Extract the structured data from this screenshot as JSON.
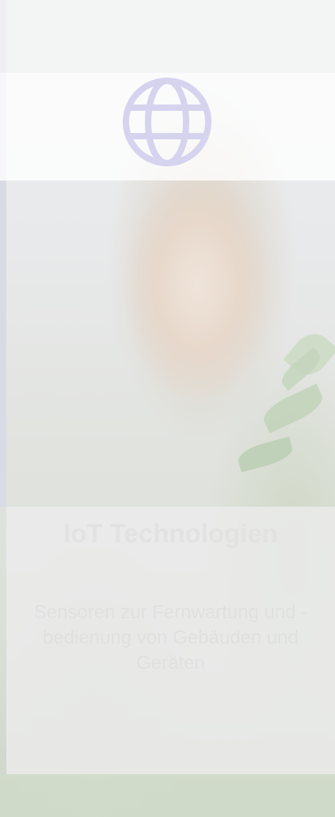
{
  "card": {
    "icon": "globe-icon",
    "title": "IoT Technologien",
    "description": "Sensoren zur Fernwartung und -bedienung von Gebäuden und Geräten",
    "colors": {
      "icon": "#d6d3ef",
      "overlay": "#ececec",
      "text": "#e2e2e2"
    }
  }
}
